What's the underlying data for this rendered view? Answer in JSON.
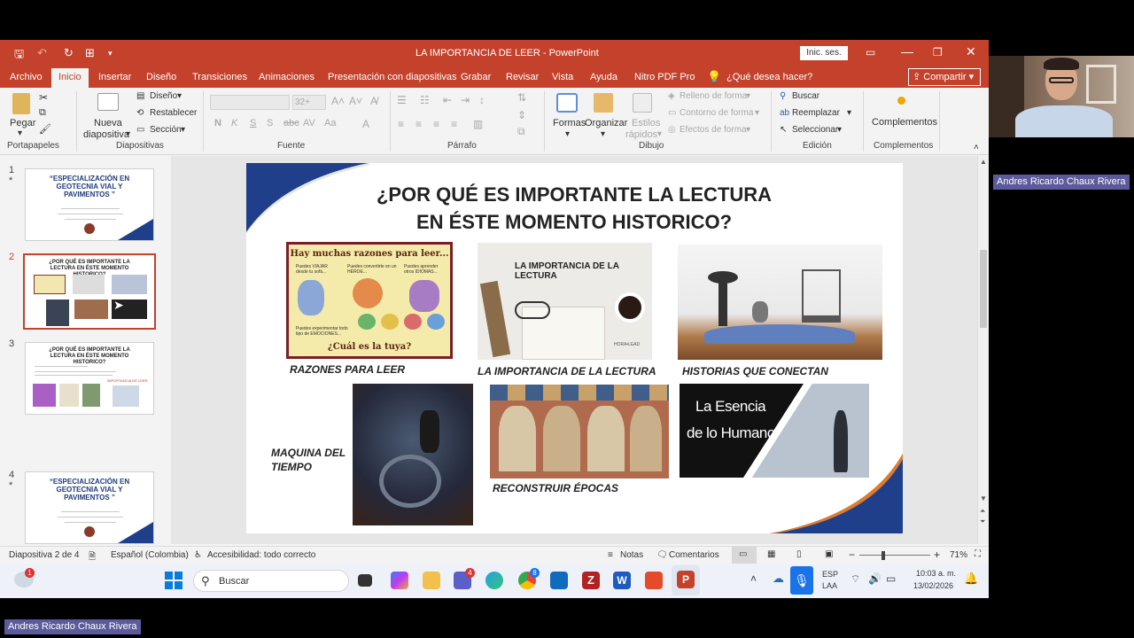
{
  "window": {
    "title": "LA IMPORTANCIA DE LEER - PowerPoint",
    "signin_label": "Inic. ses.",
    "share_label": "Compartir"
  },
  "tabs": [
    "Archivo",
    "Inicio",
    "Insertar",
    "Diseño",
    "Transiciones",
    "Animaciones",
    "Presentación con diapositivas",
    "Grabar",
    "Revisar",
    "Vista",
    "Ayuda",
    "Nitro PDF Pro"
  ],
  "tell_me": "¿Qué desea hacer?",
  "ribbon": {
    "paste": "Pegar",
    "new_slide_line1": "Nueva",
    "new_slide_line2": "diapositiva",
    "layout": "Diseño",
    "reset": "Restablecer",
    "section": "Sección",
    "font_size": "32+",
    "shapes": "Formas",
    "arrange": "Organizar",
    "quick_styles_line1": "Estilos",
    "quick_styles_line2": "rápidos",
    "shape_fill": "Relleno de forma",
    "shape_outline": "Contorno de forma",
    "shape_effects": "Efectos de forma",
    "find": "Buscar",
    "replace": "Reemplazar",
    "select": "Seleccionar",
    "addins": "Complementos",
    "groups": {
      "clipboard": "Portapapeles",
      "slides": "Diapositivas",
      "font": "Fuente",
      "paragraph": "Párrafo",
      "drawing": "Dibujo",
      "editing": "Edición",
      "addins": "Complementos"
    }
  },
  "thumbnails": [
    {
      "num": "1",
      "star": "*",
      "title": "“ESPECIALIZACIÓN EN GEOTECNIA VIAL Y PAVIMENTOS ”"
    },
    {
      "num": "2",
      "star": "",
      "title": "¿POR QUÉ ES IMPORTANTE LA LECTURA EN ÉSTE MOMENTO HISTORICO?"
    },
    {
      "num": "3",
      "star": "",
      "title": "¿POR QUÉ ES IMPORTANTE LA LECTURA EN ÉSTE MOMENTO HISTORICO?",
      "sub": "IMPORTANCIA DE LEER"
    },
    {
      "num": "4",
      "star": "*",
      "title": "“ESPECIALIZACIÓN EN GEOTECNIA VIAL Y PAVIMENTOS ”"
    }
  ],
  "slide": {
    "title_line1": "¿POR QUÉ ES IMPORTANTE LA LECTURA",
    "title_line2": "EN ÉSTE MOMENTO HISTORICO?",
    "captions": {
      "razones": "RAZONES PARA LEER",
      "importancia": "LA IMPORTANCIA DE LA LECTURA",
      "historias": "HISTORIAS QUE CONECTAN",
      "maquina_line1": "MAQUINA DEL",
      "maquina_line2": "TIEMPO",
      "reconstruir": "RECONSTRUIR ÉPOCAS"
    },
    "img_razones": {
      "header": "Hay muchas razones para leer...",
      "t1": "Puedes VIAJAR desde tu sofá...",
      "t2": "Puedes convertirte en un HÉROE...",
      "t3": "Puedes aprender otros IDIOMAS...",
      "t4": "Puedes experimentar todo tipo de EMOCIONES...",
      "footer": "¿Cuál es la tuya?"
    },
    "img_importancia": {
      "text": "LA IMPORTANCIA DE LA LECTURA",
      "brand": "HORA•LEAD"
    },
    "img_esencia": {
      "line1": "La Esencia",
      "line2": "de lo Humano"
    }
  },
  "status": {
    "slide_of": "Diapositiva 2 de 4",
    "language": "Español (Colombia)",
    "accessibility": "Accesibilidad: todo correcto",
    "notes": "Notas",
    "comments": "Comentarios",
    "zoom": "71%"
  },
  "taskbar": {
    "search_placeholder": "Buscar",
    "lang1": "ESP",
    "lang2": "LAA",
    "time": "10:03 a. m.",
    "date": "13/02/2026",
    "weather_badge": "1",
    "teams_badge": "4",
    "chrome_badge": "8"
  },
  "participant": {
    "name": "Andres Ricardo Chaux Rivera"
  }
}
